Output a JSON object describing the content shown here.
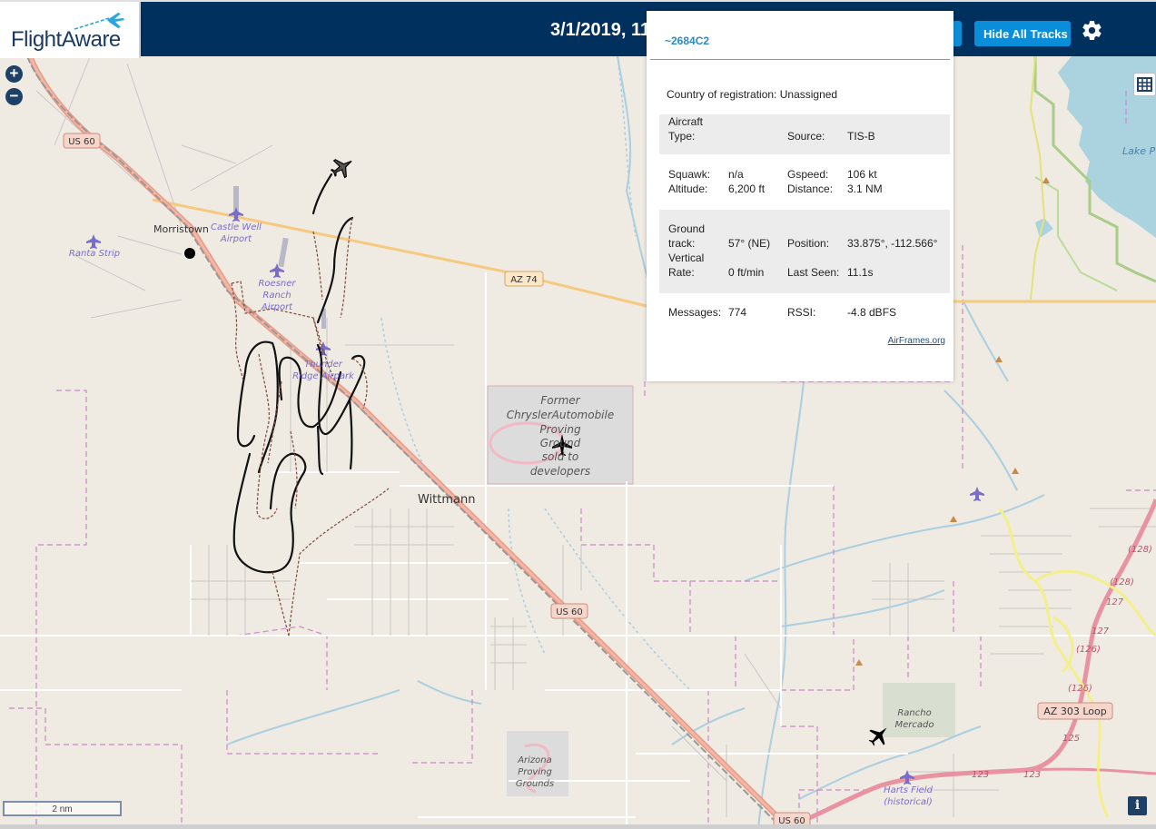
{
  "header": {
    "logo_text": "FlightAware",
    "timestamp": "3/1/2019, 11",
    "hide_tracks_label": "Hide All Tracks",
    "settings_icon": "gear-icon",
    "bg_color": "#00315e",
    "button_color": "#0b8ed9"
  },
  "map_controls": {
    "zoom_in": "+",
    "zoom_out": "−",
    "layers_icon": "grid-icon",
    "scale_label": "2 nm",
    "info_label": "i"
  },
  "map_labels": {
    "us60_a": "US 60",
    "us60_b": "US 60",
    "us60_c": "US 60",
    "az74": "AZ 74",
    "az303": "AZ 303 Loop",
    "lake": "Lake P",
    "morristown": "Morristown",
    "wittmann": "Wittmann",
    "castle_well_1": "Castle Well",
    "castle_well_2": "Airport",
    "ranta": "Ranta Strip",
    "roesner_1": "Roesner",
    "roesner_2": "Ranch",
    "roesner_3": "Airport",
    "thunder_1": "Thunder",
    "thunder_2": "Ridge Airpark",
    "chrysler_1": "Former",
    "chrysler_2": "ChryslerAutomobile",
    "chrysler_3": "Proving",
    "chrysler_4": "Ground",
    "chrysler_5": "sold to",
    "chrysler_6": "developers",
    "rancho_1": "Rancho",
    "rancho_2": "Mercado",
    "az_proving_1": "Arizona",
    "az_proving_2": "Proving",
    "az_proving_3": "Grounds",
    "harts_1": "Harts Field",
    "harts_2": "(historical)",
    "r128a": "(128)",
    "r128b": "(128)",
    "r127a": "127",
    "r127b": "127",
    "r126a": "(126)",
    "r126b": "(126)",
    "r125": "125",
    "r123a": "123",
    "r123b": "123"
  },
  "popup": {
    "title": "~2684C2",
    "registration_label": "Country of registration:",
    "registration_value": "Unassigned",
    "aircraft_type_label_1": "Aircraft",
    "aircraft_type_label_2": "Type:",
    "source_label": "Source:",
    "source_value": "TIS-B",
    "squawk_label": "Squawk:",
    "squawk_value": "n/a",
    "altitude_label": "Altitude:",
    "altitude_value": "6,200 ft",
    "gspeed_label": "Gspeed:",
    "gspeed_value": "106 kt",
    "distance_label": "Distance:",
    "distance_value": "3.1 NM",
    "ground_label_1": "Ground",
    "ground_label_2": "track:",
    "ground_value": "57° (NE)",
    "vertical_label_1": "Vertical",
    "vertical_label_2": "Rate:",
    "vertical_value": "0 ft/min",
    "position_label": "Position:",
    "position_value": "33.875°, -112.566°",
    "last_seen_label": "Last Seen:",
    "last_seen_value": "11.1s",
    "messages_label": "Messages:",
    "messages_value": "774",
    "rssi_label": "RSSI:",
    "rssi_value": "-4.8 dBFS",
    "link_label": "AirFrames.org"
  }
}
